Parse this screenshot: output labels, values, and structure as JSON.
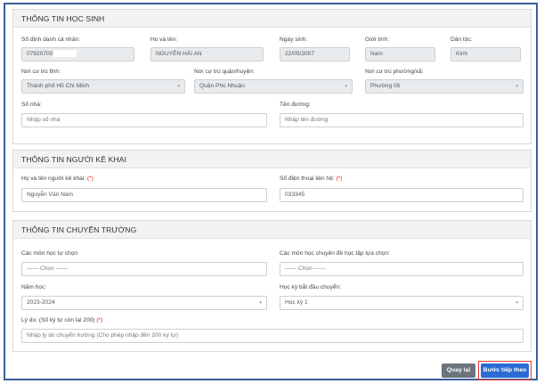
{
  "student": {
    "title": "THÔNG TIN HỌC SINH",
    "id_label": "Số định danh cá nhân:",
    "id_value": "07920700",
    "name_label": "Họ và tên:",
    "name_value": "NGUYỄN HẢI AN",
    "dob_label": "Ngày sinh:",
    "dob_value": "22/05/2007",
    "gender_label": "Giới tính:",
    "gender_value": "Nam",
    "ethnic_label": "Dân tộc:",
    "ethnic_value": "Kinh",
    "province_label": "Nơi cư trú tỉnh:",
    "province_value": "Thành phố Hồ Chí Minh",
    "district_label": "Nơi cư trú quận/huyện:",
    "district_value": "Quận Phú Nhuận",
    "ward_label": "Nơi cư trú phường/xã:",
    "ward_value": "Phường 05",
    "house_label": "Số nhà:",
    "house_placeholder": "Nhập số nhà",
    "street_label": "Tên đường:",
    "street_placeholder": "Nhập tên đường"
  },
  "declarant": {
    "title": "THÔNG TIN NGƯỜI KÊ KHAI",
    "name_label": "Họ và tên người kê khai:",
    "name_value": "Nguyễn Văn Nam",
    "phone_label": "Số điện thoại liên hệ:",
    "phone_value": "033345",
    "required_mark": "(*)"
  },
  "transfer": {
    "title": "THÔNG TIN CHUYỂN TRƯỜNG",
    "elective_label": "Các môn học tự chọn",
    "elective_value": "------ Chọn ------",
    "specialized_label": "Các môn học chuyên đề học tập lựa chọn:",
    "specialized_value": "------ Chọn ------",
    "year_label": "Năm học:",
    "year_value": "2023-2024",
    "semester_label": "Học kỳ bắt đầu chuyển:",
    "semester_value": "Học kỳ 1",
    "reason_label": "Lý do: (Số ký tự còn lại 200)",
    "reason_placeholder": "Nhập lý do chuyển trường (Cho phép nhập đến 200 ký tự)",
    "required_mark": "(*)"
  },
  "actions": {
    "back_label": "Quay lại",
    "next_label": "Bước tiếp theo"
  },
  "icons": {
    "select_caret": "chevron-down-icon",
    "caret_glyph": "▾"
  },
  "colors": {
    "frame_border": "#3a5f9a",
    "next_button": "#2b6cd4",
    "back_button": "#6c757d",
    "highlight": "#e53935",
    "required": "#e02020"
  }
}
